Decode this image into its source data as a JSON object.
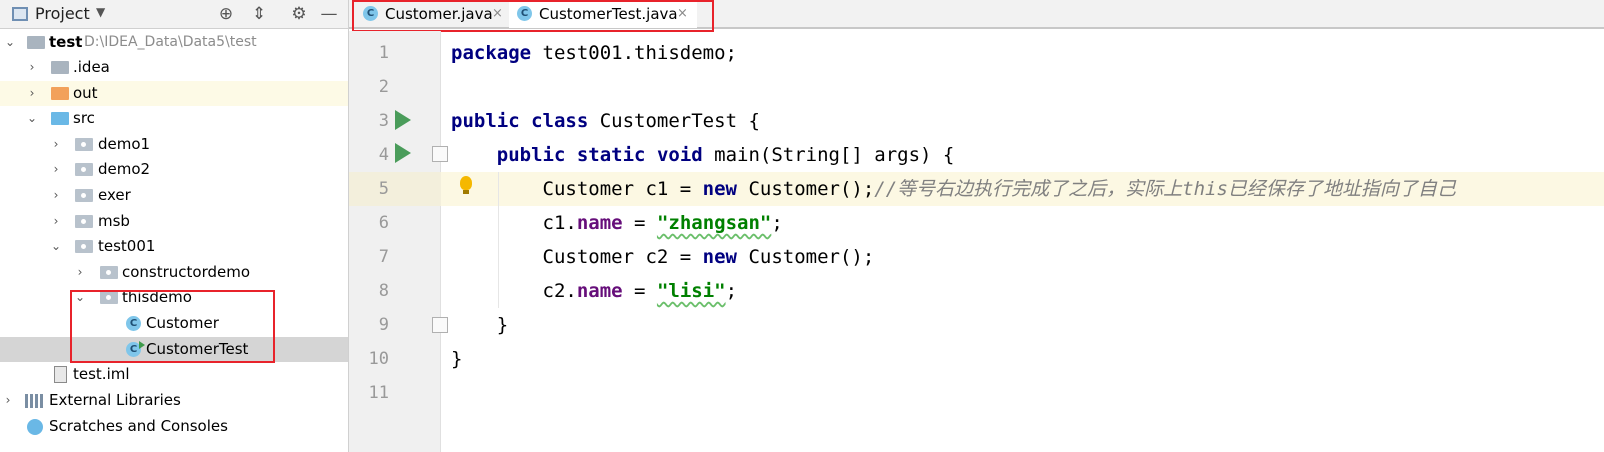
{
  "project_panel": {
    "title": "Project",
    "toolbar_icons": [
      "locate-icon",
      "collapse-icon",
      "gear-icon",
      "minimize-icon"
    ],
    "tree": [
      {
        "label": "test",
        "path": "D:\\IDEA_Data\\Data5\\test",
        "bold": true,
        "expanded": true,
        "icon": "project-folder"
      },
      {
        "label": ".idea",
        "expanded": false,
        "icon": "folder-gray"
      },
      {
        "label": "out",
        "expanded": false,
        "icon": "folder-orange"
      },
      {
        "label": "src",
        "expanded": true,
        "icon": "folder-source"
      },
      {
        "label": "demo1",
        "expanded": false,
        "icon": "package"
      },
      {
        "label": "demo2",
        "expanded": false,
        "icon": "package"
      },
      {
        "label": "exer",
        "expanded": false,
        "icon": "package"
      },
      {
        "label": "msb",
        "expanded": false,
        "icon": "package"
      },
      {
        "label": "test001",
        "expanded": true,
        "icon": "package"
      },
      {
        "label": "constructordemo",
        "expanded": false,
        "icon": "package"
      },
      {
        "label": "thisdemo",
        "expanded": true,
        "icon": "package"
      },
      {
        "label": "Customer",
        "icon": "class"
      },
      {
        "label": "CustomerTest",
        "icon": "class-runnable",
        "selected": true
      },
      {
        "label": "test.iml",
        "icon": "iml-file"
      },
      {
        "label": "External Libraries",
        "expanded": false,
        "icon": "libraries"
      },
      {
        "label": "Scratches and Consoles",
        "icon": "scratches"
      }
    ]
  },
  "tabs": [
    {
      "label": "Customer.java",
      "active": false,
      "icon_letter": "C"
    },
    {
      "label": "CustomerTest.java",
      "active": true,
      "icon_letter": "C"
    }
  ],
  "tab_close_glyph": "×",
  "editor": {
    "line_numbers": [
      "1",
      "2",
      "3",
      "4",
      "5",
      "6",
      "7",
      "8",
      "9",
      "10",
      "11"
    ],
    "current_line": 5,
    "lines": [
      {
        "no": 1,
        "tokens": [
          {
            "t": "package",
            "c": "kw"
          },
          {
            "t": " test001.thisdemo;"
          }
        ]
      },
      {
        "no": 2,
        "tokens": []
      },
      {
        "no": 3,
        "tokens": [
          {
            "t": "public",
            "c": "kw"
          },
          {
            "t": " "
          },
          {
            "t": "class",
            "c": "kw"
          },
          {
            "t": " CustomerTest {"
          }
        ]
      },
      {
        "no": 4,
        "tokens": [
          {
            "t": "    "
          },
          {
            "t": "public",
            "c": "kw"
          },
          {
            "t": " "
          },
          {
            "t": "static",
            "c": "kw"
          },
          {
            "t": " "
          },
          {
            "t": "void",
            "c": "kw"
          },
          {
            "t": " main(String[] args) {"
          }
        ]
      },
      {
        "no": 5,
        "tokens": [
          {
            "t": "        Customer c1 = "
          },
          {
            "t": "new",
            "c": "kw"
          },
          {
            "t": " Customer();"
          },
          {
            "t": "//等号右边执行完成了之后，实际上this已经保存了地址指向了自己",
            "c": "cmt"
          }
        ]
      },
      {
        "no": 6,
        "tokens": [
          {
            "t": "        c1."
          },
          {
            "t": "name",
            "c": "field"
          },
          {
            "t": " = "
          },
          {
            "t": "\"zhangsan\"",
            "c": "str"
          },
          {
            "t": ";"
          }
        ]
      },
      {
        "no": 7,
        "tokens": [
          {
            "t": "        Customer c2 = "
          },
          {
            "t": "new",
            "c": "kw"
          },
          {
            "t": " Customer();"
          }
        ]
      },
      {
        "no": 8,
        "tokens": [
          {
            "t": "        c2."
          },
          {
            "t": "name",
            "c": "field"
          },
          {
            "t": " = "
          },
          {
            "t": "\"lisi\"",
            "c": "str"
          },
          {
            "t": ";"
          }
        ]
      },
      {
        "no": 9,
        "tokens": [
          {
            "t": "    }"
          }
        ]
      },
      {
        "no": 10,
        "tokens": [
          {
            "t": "}"
          }
        ]
      },
      {
        "no": 11,
        "tokens": []
      }
    ]
  },
  "colors": {
    "keyword": "#000080",
    "field": "#660e7a",
    "string": "#008000",
    "comment": "#808080",
    "highlight_box": "#e8232b",
    "current_line": "#fcf8e3"
  }
}
